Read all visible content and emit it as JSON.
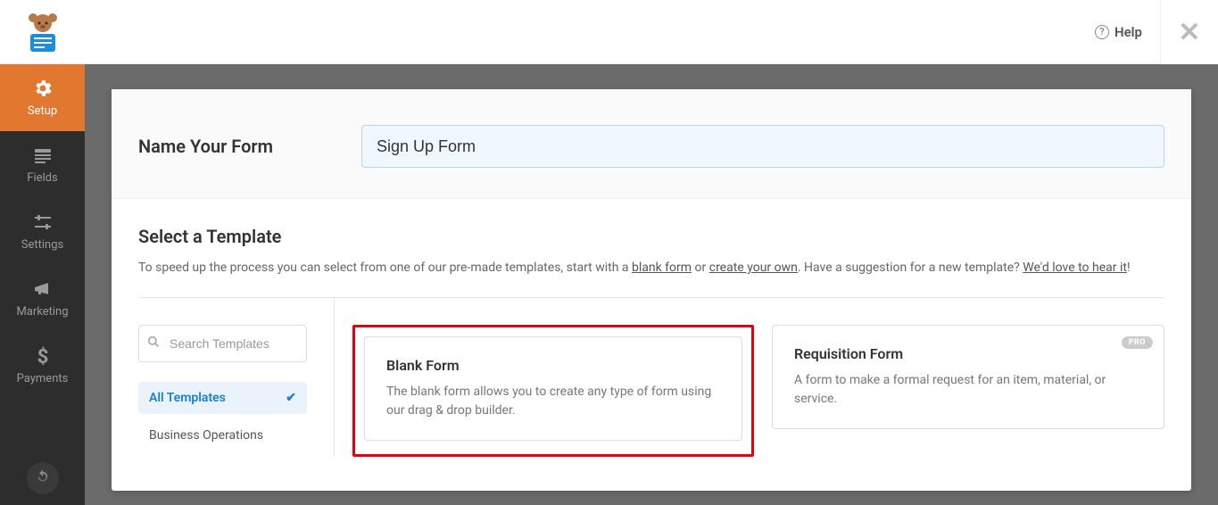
{
  "topbar": {
    "help_label": "Help"
  },
  "sidenav": {
    "items": [
      {
        "label": "Setup"
      },
      {
        "label": "Fields"
      },
      {
        "label": "Settings"
      },
      {
        "label": "Marketing"
      },
      {
        "label": "Payments"
      }
    ]
  },
  "form_name": {
    "label": "Name Your Form",
    "value": "Sign Up Form"
  },
  "templates": {
    "heading": "Select a Template",
    "desc_pre": "To speed up the process you can select from one of our pre-made templates, start with a ",
    "link_blank": "blank form",
    "desc_or": " or ",
    "link_create": "create your own",
    "desc_post": ". Have a suggestion for a new template? ",
    "link_feedback": "We'd love to hear it",
    "desc_end": "!",
    "search_placeholder": "Search Templates",
    "categories": [
      {
        "label": "All Templates",
        "active": true
      },
      {
        "label": "Business Operations",
        "active": false
      }
    ],
    "cards": [
      {
        "title": "Blank Form",
        "desc": "The blank form allows you to create any type of form using our drag & drop builder.",
        "pro": false
      },
      {
        "title": "Requisition Form",
        "desc": "A form to make a formal request for an item, material, or service.",
        "pro": true,
        "badge": "PRO"
      }
    ]
  }
}
